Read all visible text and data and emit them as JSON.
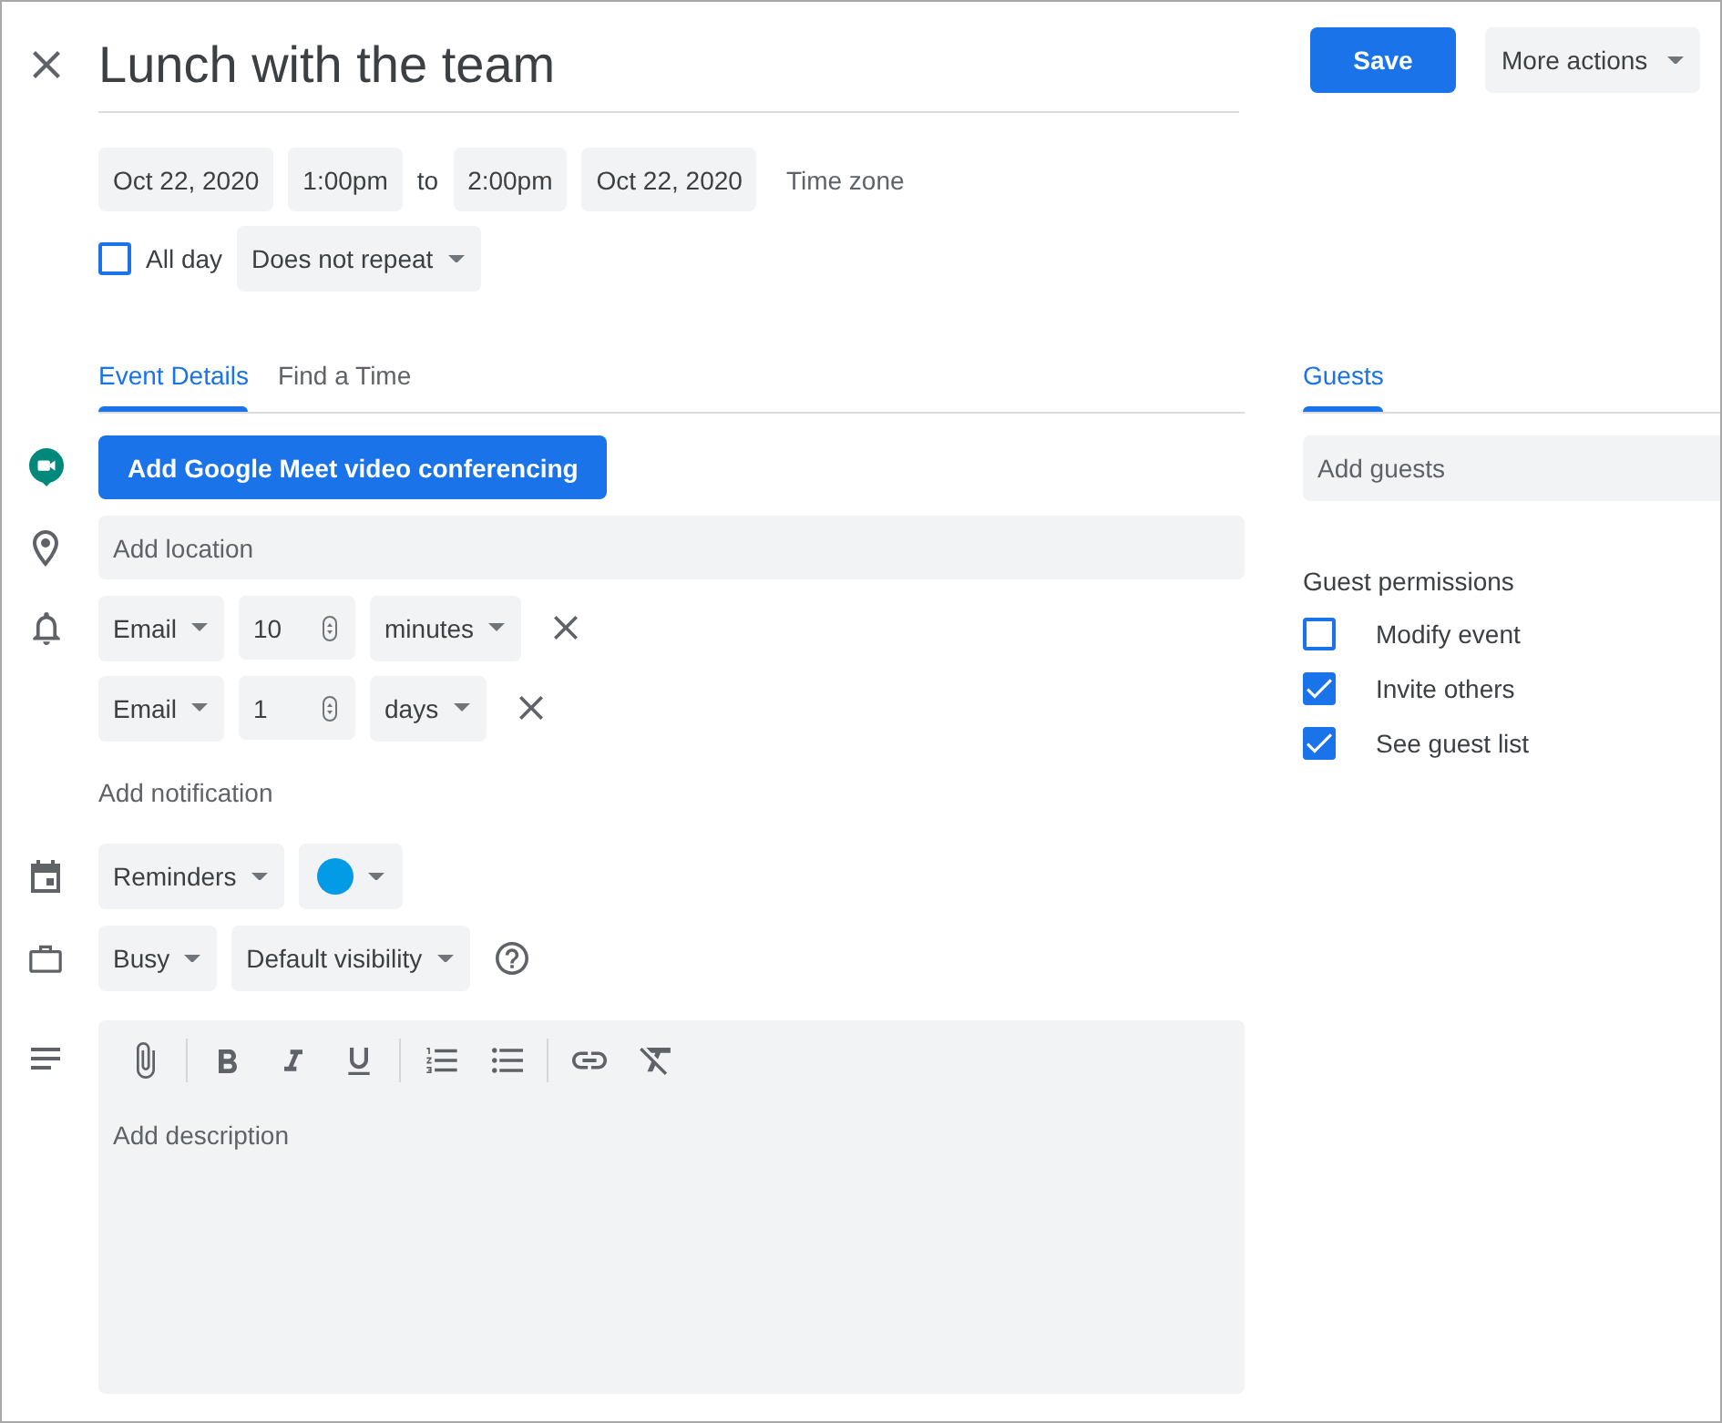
{
  "header": {
    "title": "Lunch with the team",
    "save_button": "Save",
    "more_actions": "More actions"
  },
  "schedule": {
    "start_date": "Oct 22, 2020",
    "start_time": "1:00pm",
    "separator": "to",
    "end_time": "2:00pm",
    "end_date": "Oct 22, 2020",
    "time_zone": "Time zone"
  },
  "all_day": {
    "label": "All day",
    "checked": false
  },
  "repeat": "Does not repeat",
  "tabs": [
    {
      "label": "Event Details",
      "selected": true
    },
    {
      "label": "Find a Time",
      "selected": false
    }
  ],
  "conferencing_button": "Add Google Meet video conferencing",
  "location": {
    "placeholder": "Add location"
  },
  "notifications": [
    {
      "method": "Email",
      "amount": "10",
      "unit": "minutes"
    },
    {
      "method": "Email",
      "amount": "1",
      "unit": "days"
    }
  ],
  "add_notification": "Add notification",
  "calendar": {
    "name": "Reminders",
    "color": "#039be5"
  },
  "availability": "Busy",
  "visibility": "Default visibility",
  "description": {
    "placeholder": "Add description"
  },
  "guests": {
    "tabs": [
      {
        "label": "Guests",
        "selected": true
      }
    ],
    "search": {
      "placeholder": "Add guests"
    },
    "permissions_heading": "Guest permissions",
    "permissions": [
      {
        "label": "Modify event",
        "checked": false
      },
      {
        "label": "Invite others",
        "checked": true
      },
      {
        "label": "See guest list",
        "checked": true
      }
    ]
  }
}
